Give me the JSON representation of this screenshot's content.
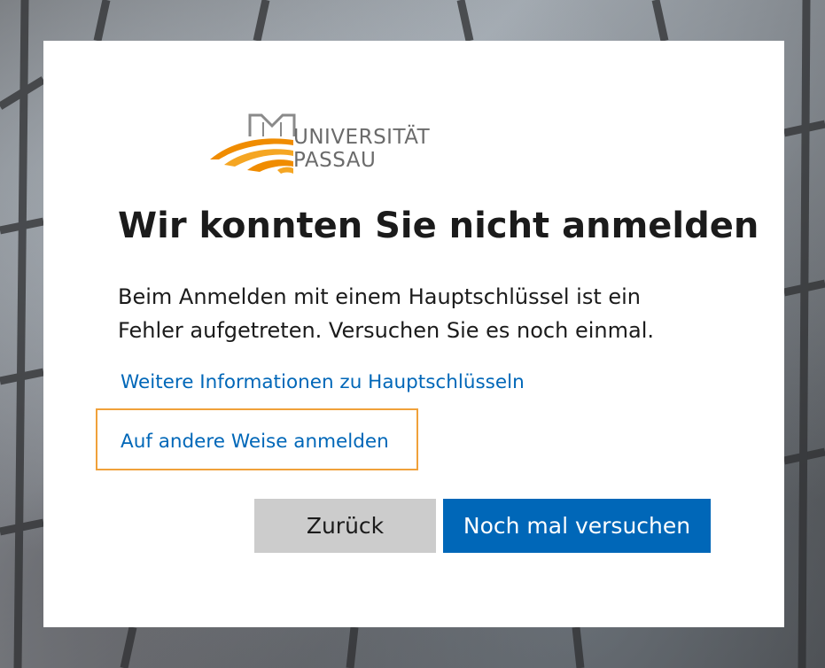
{
  "logo": {
    "line1": "UNIVERSITÄT",
    "line2": "PASSAU",
    "colors": {
      "accent": "#f08c00",
      "text": "#6b6b6b"
    }
  },
  "dialog": {
    "title": "Wir konnten Sie nicht anmelden",
    "description": "Beim Anmelden mit einem Hauptschlüssel ist ein Fehler aufgetreten. Versuchen Sie es noch einmal.",
    "info_link": "Weitere Informationen zu Hauptschlüsseln",
    "other_signin_link": "Auf andere Weise anmelden",
    "back_button": "Zurück",
    "retry_button": "Noch mal versuchen"
  },
  "colors": {
    "link": "#0067b8",
    "primary_button": "#0067b8",
    "secondary_button": "#cccccc",
    "focus_outline": "#f0a13a"
  }
}
